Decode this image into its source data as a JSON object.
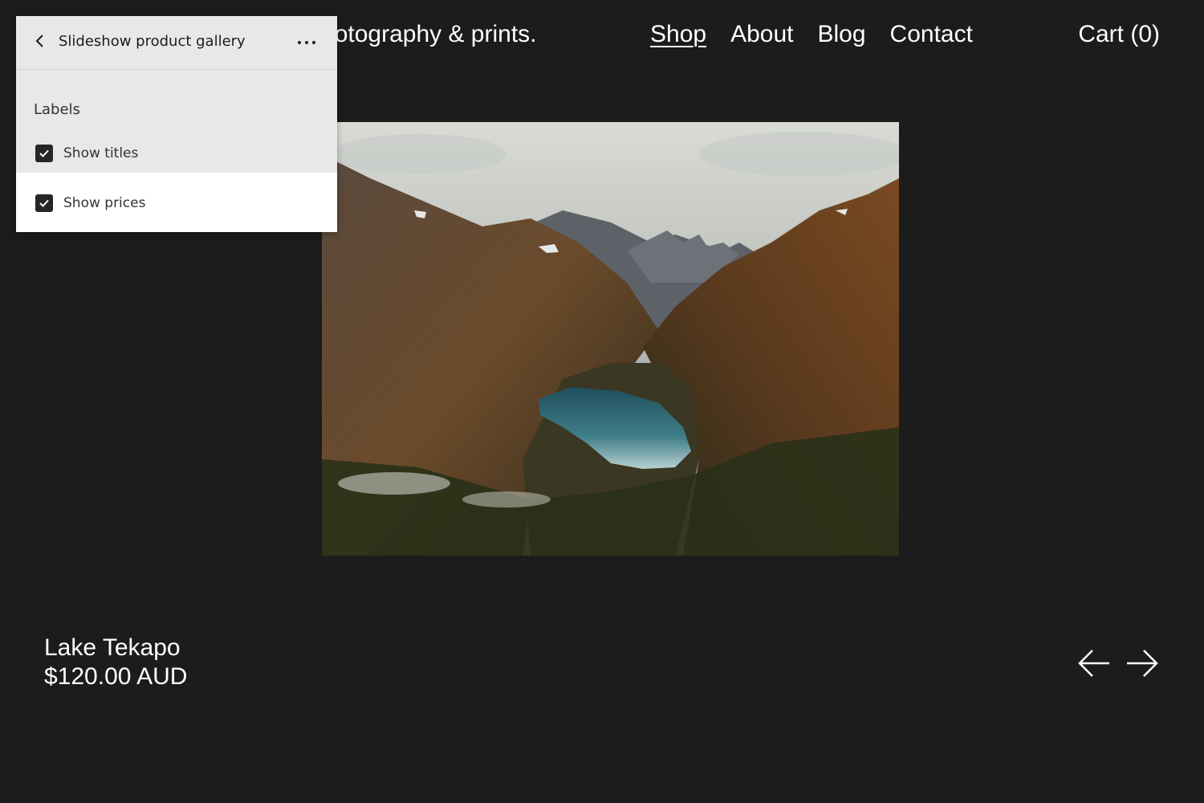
{
  "header": {
    "site_title": "Photography & prints.",
    "nav": [
      {
        "label": "Shop",
        "active": true
      },
      {
        "label": "About"
      },
      {
        "label": "Blog"
      },
      {
        "label": "Contact"
      }
    ],
    "cart_label": "Cart (0)"
  },
  "product": {
    "title": "Lake Tekapo",
    "price": "$120.00 AUD"
  },
  "controls": {
    "prev_icon": "arrow-left-icon",
    "next_icon": "arrow-right-icon"
  },
  "panel": {
    "title": "Slideshow product gallery",
    "back_icon": "chevron-left-icon",
    "more_icon": "more-horizontal-icon",
    "section_label": "Labels",
    "options": [
      {
        "label": "Show titles",
        "checked": true
      },
      {
        "label": "Show prices",
        "checked": true
      }
    ]
  },
  "colors": {
    "background": "#1c1c1c",
    "panel": "#e8e8e8",
    "text": "#ffffff"
  }
}
